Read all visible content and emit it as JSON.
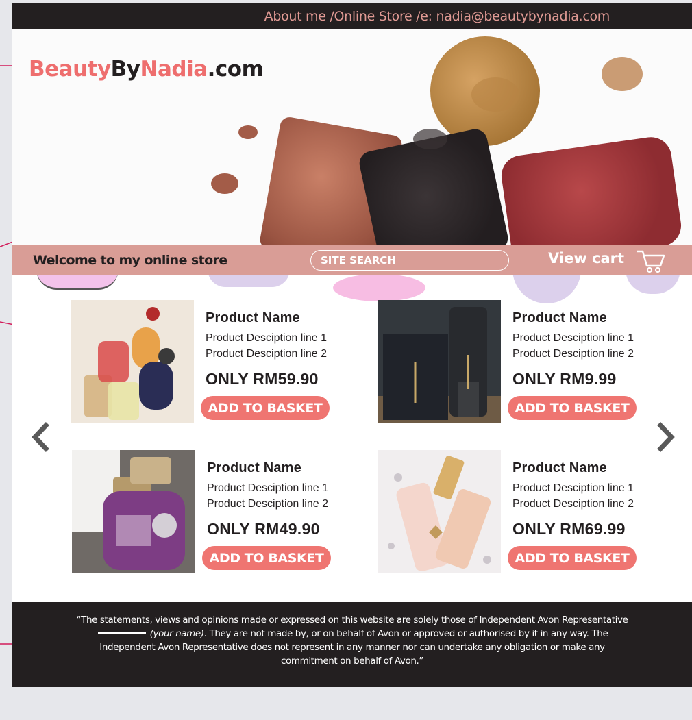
{
  "topbar": {
    "links_text": "About me /Online Store /e: nadia@beautybynadia.com"
  },
  "brand": {
    "part1": "Beauty",
    "part2": "By",
    "part3": "Nadia",
    "part4": ".com"
  },
  "strip": {
    "welcome": "Welcome to my online store",
    "search_placeholder": "SITE SEARCH",
    "view_cart": "View cart"
  },
  "products": [
    {
      "name": "Product Name",
      "desc1": "Product Desciption line 1",
      "desc2": "Product Desciption line 2",
      "price": "ONLY RM59.90",
      "button": "ADD TO BASKET"
    },
    {
      "name": "Product Name",
      "desc1": "Product Desciption line 1",
      "desc2": "Product Desciption line 2",
      "price": "ONLY RM9.99",
      "button": "ADD TO BASKET"
    },
    {
      "name": "Product Name",
      "desc1": "Product Desciption line 1",
      "desc2": "Product Desciption line 2",
      "price": "ONLY RM49.90",
      "button": "ADD TO BASKET"
    },
    {
      "name": "Product Name",
      "desc1": "Product Desciption line 1",
      "desc2": "Product Desciption line 2",
      "price": "ONLY RM69.99",
      "button": "ADD TO BASKET"
    }
  ],
  "footer": {
    "line_start": "“The statements, views and opinions made or expressed on this website are solely those of Independent Avon Representative",
    "placeholder": "(your name)",
    "line_end": ". They are not made by, or on behalf of Avon or approved or authorised by it in any way. The Independent Avon Representative does not represent in any manner nor can undertake any obligation or make any commitment on behalf of Avon.”"
  },
  "colors": {
    "accent": "#ee6e6e",
    "dark": "#231f20",
    "strip": "#d99d96",
    "button": "#ef7571"
  },
  "icons": {
    "cart": "cart-icon",
    "prev": "chevron-left-icon",
    "next": "chevron-right-icon"
  }
}
